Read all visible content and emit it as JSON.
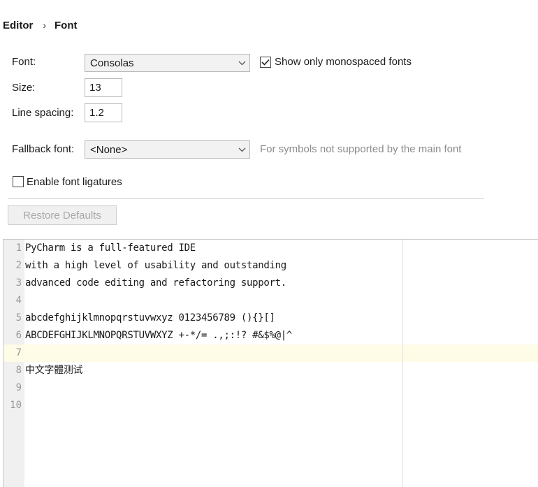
{
  "breadcrumb": {
    "parent": "Editor",
    "separator": "›",
    "current": "Font"
  },
  "form": {
    "font_label": "Font:",
    "font_value": "Consolas",
    "monospaced_label": "Show only monospaced fonts",
    "monospaced_checked": true,
    "size_label": "Size:",
    "size_value": "13",
    "line_spacing_label": "Line spacing:",
    "line_spacing_value": "1.2",
    "fallback_label": "Fallback font:",
    "fallback_value": "<None>",
    "fallback_hint": "For symbols not supported by the main font",
    "ligatures_label": "Enable font ligatures",
    "ligatures_checked": false,
    "restore_label": "Restore Defaults"
  },
  "editor": {
    "current_line": 7,
    "lines": [
      {
        "num": "1",
        "text": "PyCharm is a full-featured IDE"
      },
      {
        "num": "2",
        "text": "with a high level of usability and outstanding"
      },
      {
        "num": "3",
        "text": "advanced code editing and refactoring support."
      },
      {
        "num": "4",
        "text": ""
      },
      {
        "num": "5",
        "text": "abcdefghijklmnopqrstuvwxyz 0123456789 (){}[]"
      },
      {
        "num": "6",
        "text": "ABCDEFGHIJKLMNOPQRSTUVWXYZ +-*/= .,;:!? #&$%@|^"
      },
      {
        "num": "7",
        "text": ""
      },
      {
        "num": "8",
        "text": "中文字體测试"
      },
      {
        "num": "9",
        "text": ""
      },
      {
        "num": "10",
        "text": ""
      }
    ]
  }
}
